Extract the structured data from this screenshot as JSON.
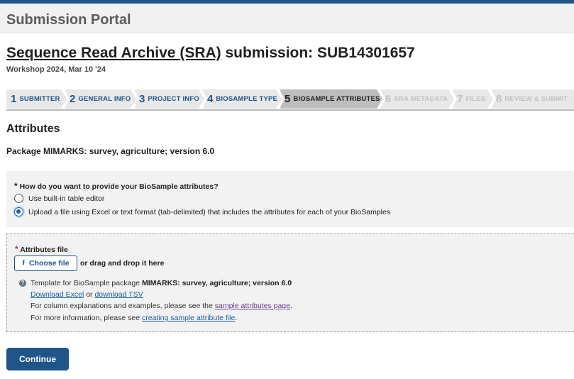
{
  "header": {
    "portal_title": "Submission Portal"
  },
  "submission": {
    "title_link": "Sequence Read Archive (SRA)",
    "title_rest": " submission: SUB14301657",
    "meta": "Workshop 2024, Mar 10 '24"
  },
  "steps": [
    {
      "num": "1",
      "label": "SUBMITTER",
      "state": "done"
    },
    {
      "num": "2",
      "label": "GENERAL INFO",
      "state": "done"
    },
    {
      "num": "3",
      "label": "PROJECT INFO",
      "state": "done"
    },
    {
      "num": "4",
      "label": "BIOSAMPLE TYPE",
      "state": "done"
    },
    {
      "num": "5",
      "label": "BIOSAMPLE ATTRIBUTES",
      "state": "active"
    },
    {
      "num": "6",
      "label": "SRA METADATA",
      "state": "disabled"
    },
    {
      "num": "7",
      "label": "FILES",
      "state": "disabled"
    },
    {
      "num": "8",
      "label": "REVIEW & SUBMIT",
      "state": "disabled"
    }
  ],
  "section": {
    "title": "Attributes",
    "package": "Package MIMARKS: survey, agriculture; version 6.0"
  },
  "question": {
    "asterisk": "*",
    "label": "How do you want to provide your BioSample attributes?",
    "options": [
      {
        "label": "Use built-in table editor",
        "checked": false
      },
      {
        "label": "Upload a file using Excel or text format (tab-delimited) that includes the attributes for each of your BioSamples",
        "checked": true
      }
    ]
  },
  "file_upload": {
    "asterisk": "*",
    "label": "Attributes file",
    "choose_button": "Choose file",
    "upload_icon": "upload-icon",
    "drag_text": "or drag and drop it here",
    "info_icon": "info-icon",
    "template_prefix": "Template for BioSample package ",
    "template_package": "MIMARKS: survey, agriculture; version 6.0",
    "download_excel": "Download Excel",
    "or": " or ",
    "download_tsv": "download TSV",
    "explain_prefix": "For column explanations and examples, please see the ",
    "sample_attributes_link": "sample attributes page",
    "explain_suffix": ".",
    "more_prefix": "For more information, please see ",
    "creating_link": "creating sample attribute file",
    "more_suffix": "."
  },
  "actions": {
    "continue": "Continue"
  },
  "colors": {
    "primary": "#20558a",
    "link": "#1a5ea8",
    "required": "#c0392b"
  }
}
